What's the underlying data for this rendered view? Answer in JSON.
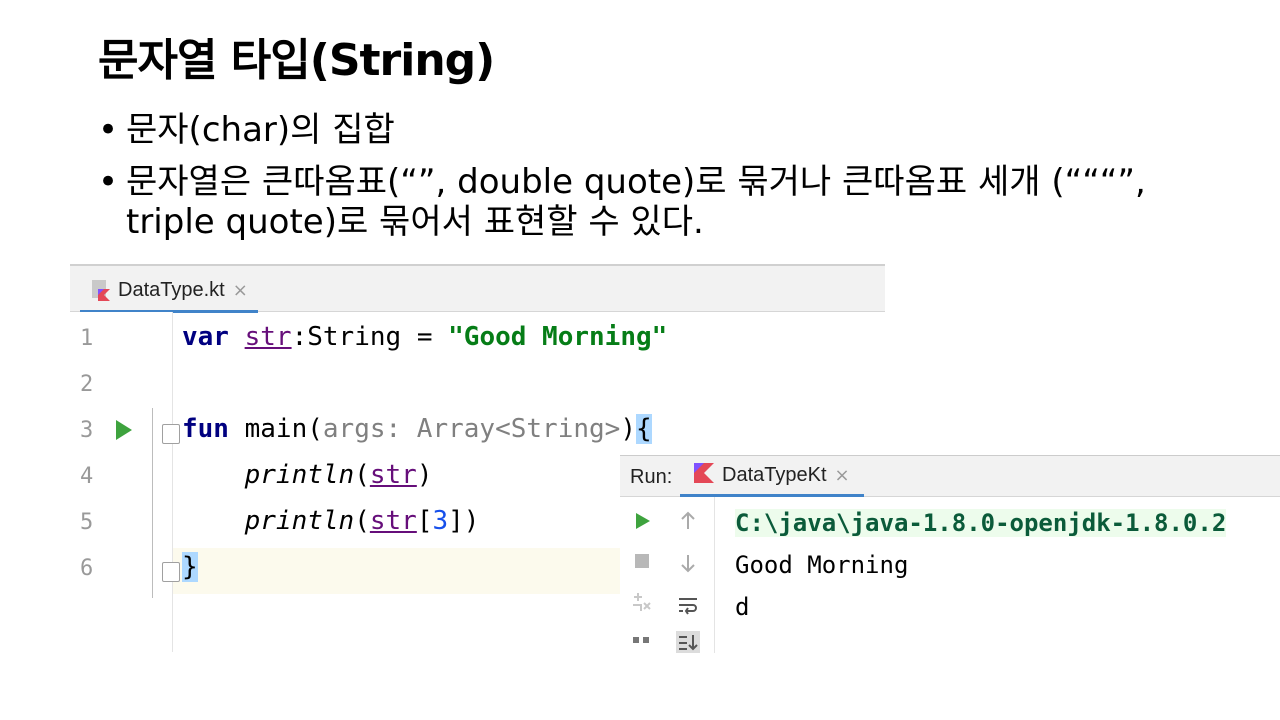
{
  "slide": {
    "title": "문자열 타입(String)",
    "bullets": [
      "문자(char)의 집합",
      "문자열은 큰따옴표(“”, double quote)로 묶거나 큰따옴표 세개 (“““”, triple quote)로 묶어서 표현할 수 있다."
    ],
    "bullet_marker": "•"
  },
  "editor": {
    "tab": {
      "label": "DataType.kt",
      "close": "×",
      "icon": "kotlin-file-icon"
    },
    "line_numbers": [
      "1",
      "2",
      "3",
      "4",
      "5",
      "6"
    ],
    "code": {
      "l1_kw": "var",
      "l1_prop": "str",
      "l1_type": ":String = ",
      "l1_str": "\"Good Morning\"",
      "l3_kw": "fun",
      "l3_name": " main(",
      "l3_param": "args: Array<String>",
      "l3_close": ")",
      "l3_brace": "{",
      "l4_indent": "    ",
      "l4_fn": "println",
      "l4_open": "(",
      "l4_prop": "str",
      "l4_close": ")",
      "l5_indent": "    ",
      "l5_fn": "println",
      "l5_open": "(",
      "l5_prop": "str",
      "l5_idx_open": "[",
      "l5_num": "3",
      "l5_idx_close": "])",
      "l6_brace": "}"
    },
    "current_line": 6
  },
  "run_panel": {
    "label": "Run:",
    "tab_label": "DataTypeKt",
    "tab_close": "×",
    "tab_icon": "kotlin-icon",
    "tools": {
      "left": [
        "run-icon",
        "stop-icon",
        "pin-icon",
        "layout-icon"
      ],
      "right": [
        "up-arrow-icon",
        "down-arrow-icon",
        "soft-wrap-icon",
        "scroll-to-end-icon"
      ]
    },
    "output": [
      "C:\\java\\java-1.8.0-openjdk-1.8.0.2",
      "Good Morning",
      "d"
    ]
  }
}
